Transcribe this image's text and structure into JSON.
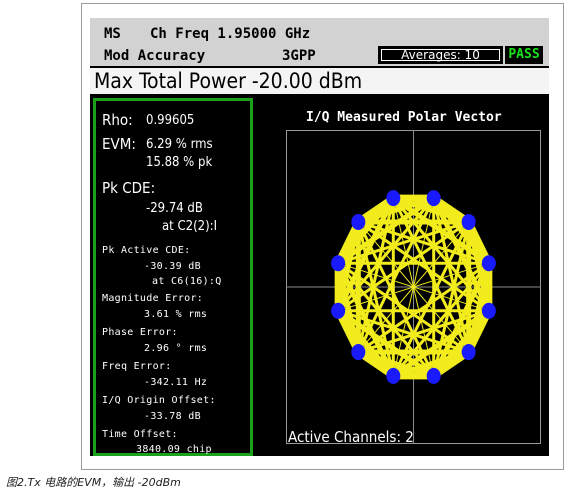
{
  "header": {
    "mode": "MS",
    "ch_freq": "Ch Freq 1.95000 GHz",
    "measurement": "Mod Accuracy",
    "standard": "3GPP",
    "averages": "Averages: 10",
    "status": "PASS"
  },
  "title": "Max Total Power -20.00 dBm",
  "results": {
    "rho_label": "Rho:",
    "rho_value": "0.99605",
    "evm_label": "EVM:",
    "evm_rms": "6.29 % rms",
    "evm_pk": "15.88 % pk",
    "pk_cde_label": "Pk CDE:",
    "pk_cde_value": "-29.74 dB",
    "pk_cde_at": "at C2(2):I",
    "pk_active_cde_label": "Pk Active CDE:",
    "pk_active_cde_value": "-30.39 dB",
    "pk_active_cde_at": "at C6(16):Q",
    "mag_err_label": "Magnitude Error:",
    "mag_err_value": "3.61 % rms",
    "phase_err_label": "Phase Error:",
    "phase_err_value": "2.96 ° rms",
    "freq_err_label": "Freq Error:",
    "freq_err_value": "-342.11 Hz",
    "iq_offset_label": "I/Q Origin Offset:",
    "iq_offset_value": "-33.78 dB",
    "time_offset_label": "Time Offset:",
    "time_offset_value": "3840.09 chip"
  },
  "plot": {
    "title": "I/Q Measured Polar Vector",
    "active_channels": "Active Channels: 2",
    "trace_color": "#f2ec1c",
    "symbol_color": "#1a1aff",
    "symbol_count": 12
  },
  "caption": "图2.Tx 电路的EVM，输出 -20dBm",
  "colors": {
    "pass": "#19e11a",
    "panel_border": "#1aa01a",
    "screen_bg": "#000000",
    "header_bg": "#d2d2d2"
  }
}
